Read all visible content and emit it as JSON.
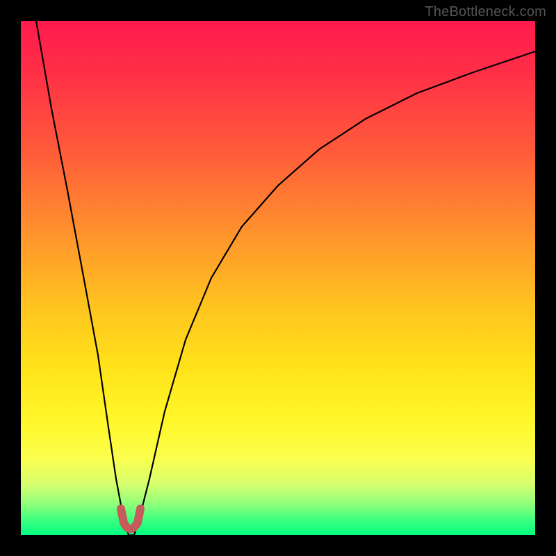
{
  "watermark": "TheBottleneck.com",
  "colors": {
    "page_bg": "#000000",
    "gradient_top": "#ff1a4d",
    "gradient_bottom": "#00ff80",
    "curve": "#000000",
    "nub": "#c75a5a",
    "watermark": "#555555"
  },
  "chart_data": {
    "type": "line",
    "title": "",
    "xlabel": "",
    "ylabel": "",
    "xlim": [
      0,
      100
    ],
    "ylim": [
      0,
      100
    ],
    "x": [
      3,
      6,
      9,
      12,
      15,
      17,
      18.5,
      20,
      21,
      22,
      23,
      25,
      28,
      32,
      37,
      43,
      50,
      58,
      67,
      77,
      88,
      100
    ],
    "values": [
      100,
      83,
      67,
      51,
      35,
      21,
      11,
      3,
      0,
      0,
      3,
      11,
      24,
      38,
      50,
      60,
      68,
      75,
      81,
      86,
      90,
      94
    ],
    "description": "Single V-shaped bottleneck curve: steep descent from top-left to minimum near x≈21 (bottom of plot), then rising asymptotically toward upper-right. Background vertical gradient red→green encodes severity (top=bad red, bottom=good green). Small rounded reddish 'U' marker sits at the curve minimum.",
    "minimum_x_percent": 21,
    "marker": {
      "shape": "u",
      "x_percent_range": [
        19,
        23
      ],
      "color": "#c75a5a"
    }
  }
}
